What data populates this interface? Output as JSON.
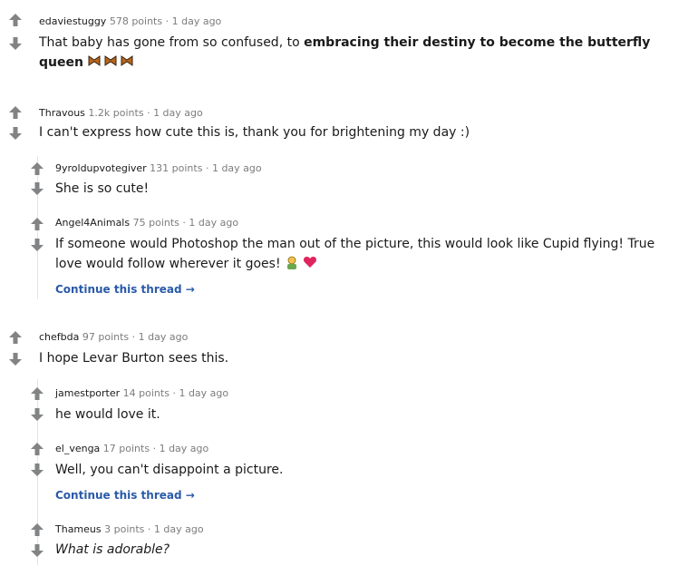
{
  "comments": [
    {
      "author": "edaviestuggy",
      "points": "578 points",
      "age": "1 day ago",
      "text_plain": "That baby has gone from so confused, to ",
      "text_bold": "embracing their destiny to become the butterfly queen",
      "emoji": "butterfly-emoji"
    },
    {
      "author": "Thravous",
      "points": "1.2k points",
      "age": "1 day ago",
      "text": "I can't express how cute this is, thank you for brightening my day :)"
    },
    {
      "author": "9yroldupvotegiver",
      "points": "131 points",
      "age": "1 day ago",
      "text": "She is so cute!"
    },
    {
      "author": "Angel4Animals",
      "points": "75 points",
      "age": "1 day ago",
      "text_line1": "If someone would Photoshop the man out of the picture, this would look like Cupid flying! True",
      "text_line2": "love would follow wherever it goes!"
    },
    {
      "author": "chefbda",
      "points": "97 points",
      "age": "1 day ago",
      "text": "I hope Levar Burton sees this."
    },
    {
      "author": "jamestporter",
      "points": "14 points",
      "age": "1 day ago",
      "text": "he would love it."
    },
    {
      "author": "el_venga",
      "points": "17 points",
      "age": "1 day ago",
      "text": "Well, you can't disappoint a picture."
    },
    {
      "author": "Thameus",
      "points": "3 points",
      "age": "1 day ago",
      "text": "What is adorable?"
    }
  ],
  "continue_thread_label": "Continue this thread",
  "meta_separator": "·",
  "colors": {
    "vote_arrow": "#818384",
    "link": "#2a5aa8",
    "meta": "#7c7c7c",
    "thread_line": "#e4e4e4"
  }
}
